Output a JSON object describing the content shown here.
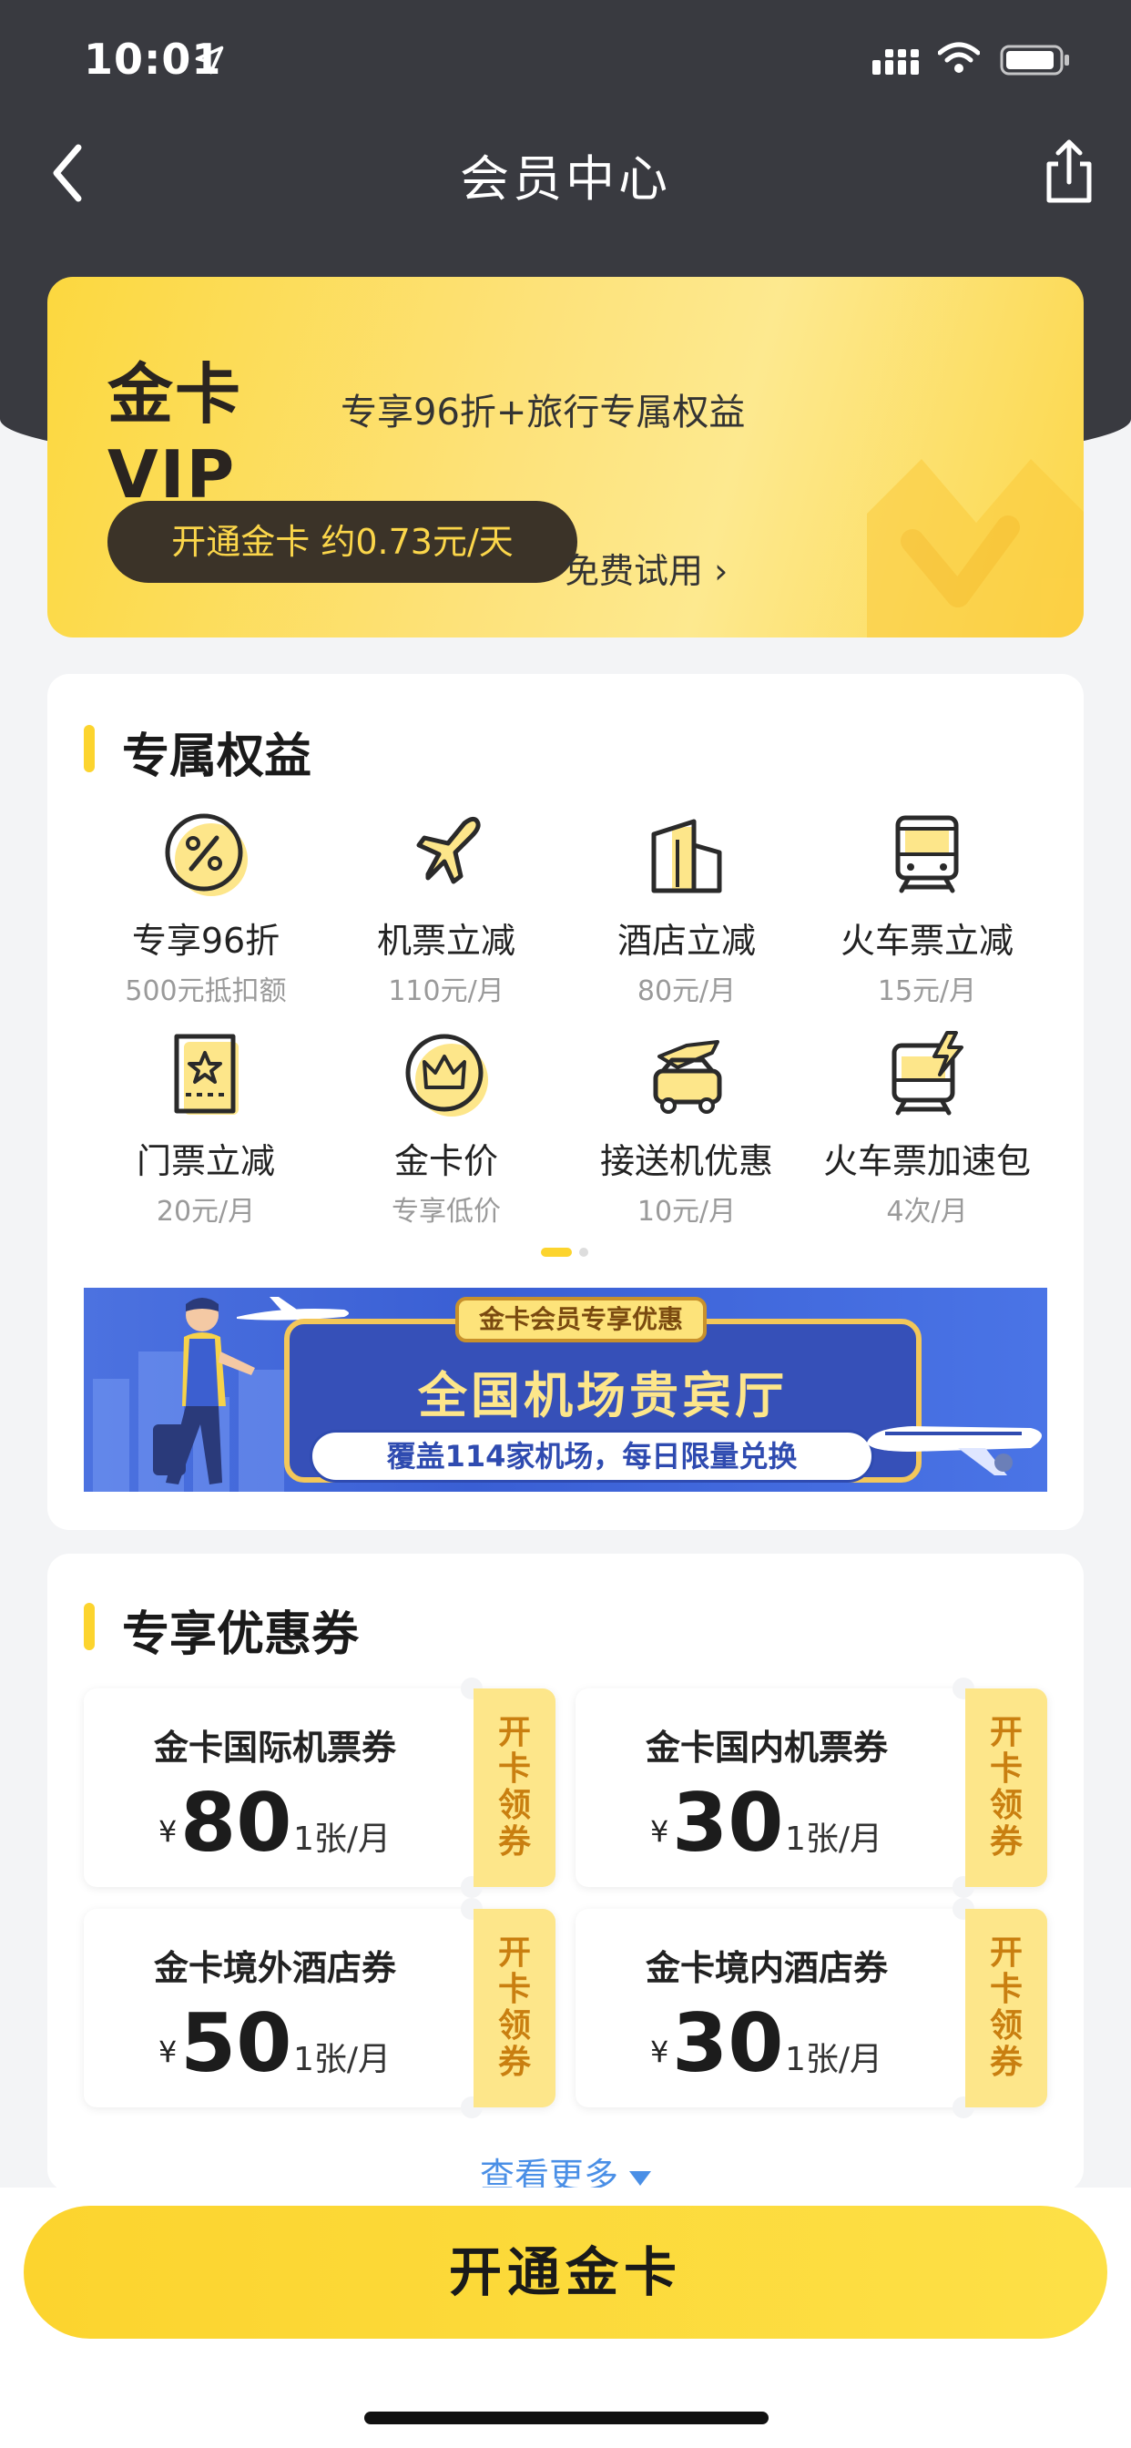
{
  "status": {
    "time": "10:01"
  },
  "nav": {
    "title": "会员中心"
  },
  "vip": {
    "logo": "金卡VIP",
    "subtitle": "专享96折+旅行专属权益",
    "open_label": "开通金卡 约0.73元/天",
    "trial_label": "免费试用 ›"
  },
  "benefits": {
    "title": "专属权益",
    "items": [
      {
        "title": "专享96折",
        "sub": "500元抵扣额",
        "icon": "percent-icon"
      },
      {
        "title": "机票立减",
        "sub": "110元/月",
        "icon": "airplane-icon"
      },
      {
        "title": "酒店立减",
        "sub": "80元/月",
        "icon": "hotel-icon"
      },
      {
        "title": "火车票立减",
        "sub": "15元/月",
        "icon": "train-icon"
      },
      {
        "title": "门票立减",
        "sub": "20元/月",
        "icon": "ticket-icon"
      },
      {
        "title": "金卡价",
        "sub": "专享低价",
        "icon": "crown-icon"
      },
      {
        "title": "接送机优惠",
        "sub": "10元/月",
        "icon": "car-plane-icon"
      },
      {
        "title": "火车票加速包",
        "sub": "4次/月",
        "icon": "train-boost-icon"
      }
    ]
  },
  "banner": {
    "tag": "金卡会员专享优惠",
    "main": "全国机场贵宾厅",
    "pill": "覆盖114家机场，每日限量兑换"
  },
  "coupons": {
    "title": "专享优惠券",
    "items": [
      {
        "name": "金卡国际机票券",
        "yen": "¥",
        "value": "80",
        "unit": "1张/月",
        "tab": [
          "开",
          "卡",
          "领",
          "券"
        ]
      },
      {
        "name": "金卡国内机票券",
        "yen": "¥",
        "value": "30",
        "unit": "1张/月",
        "tab": [
          "开",
          "卡",
          "领",
          "券"
        ]
      },
      {
        "name": "金卡境外酒店券",
        "yen": "¥",
        "value": "50",
        "unit": "1张/月",
        "tab": [
          "开",
          "卡",
          "领",
          "券"
        ]
      },
      {
        "name": "金卡境内酒店券",
        "yen": "¥",
        "value": "30",
        "unit": "1张/月",
        "tab": [
          "开",
          "卡",
          "领",
          "券"
        ]
      }
    ],
    "more_label": "查看更多"
  },
  "cta": {
    "label": "开通金卡"
  },
  "colors": {
    "accent": "#fcd42e",
    "dark": "#393a40",
    "link": "#4a8fe6"
  }
}
